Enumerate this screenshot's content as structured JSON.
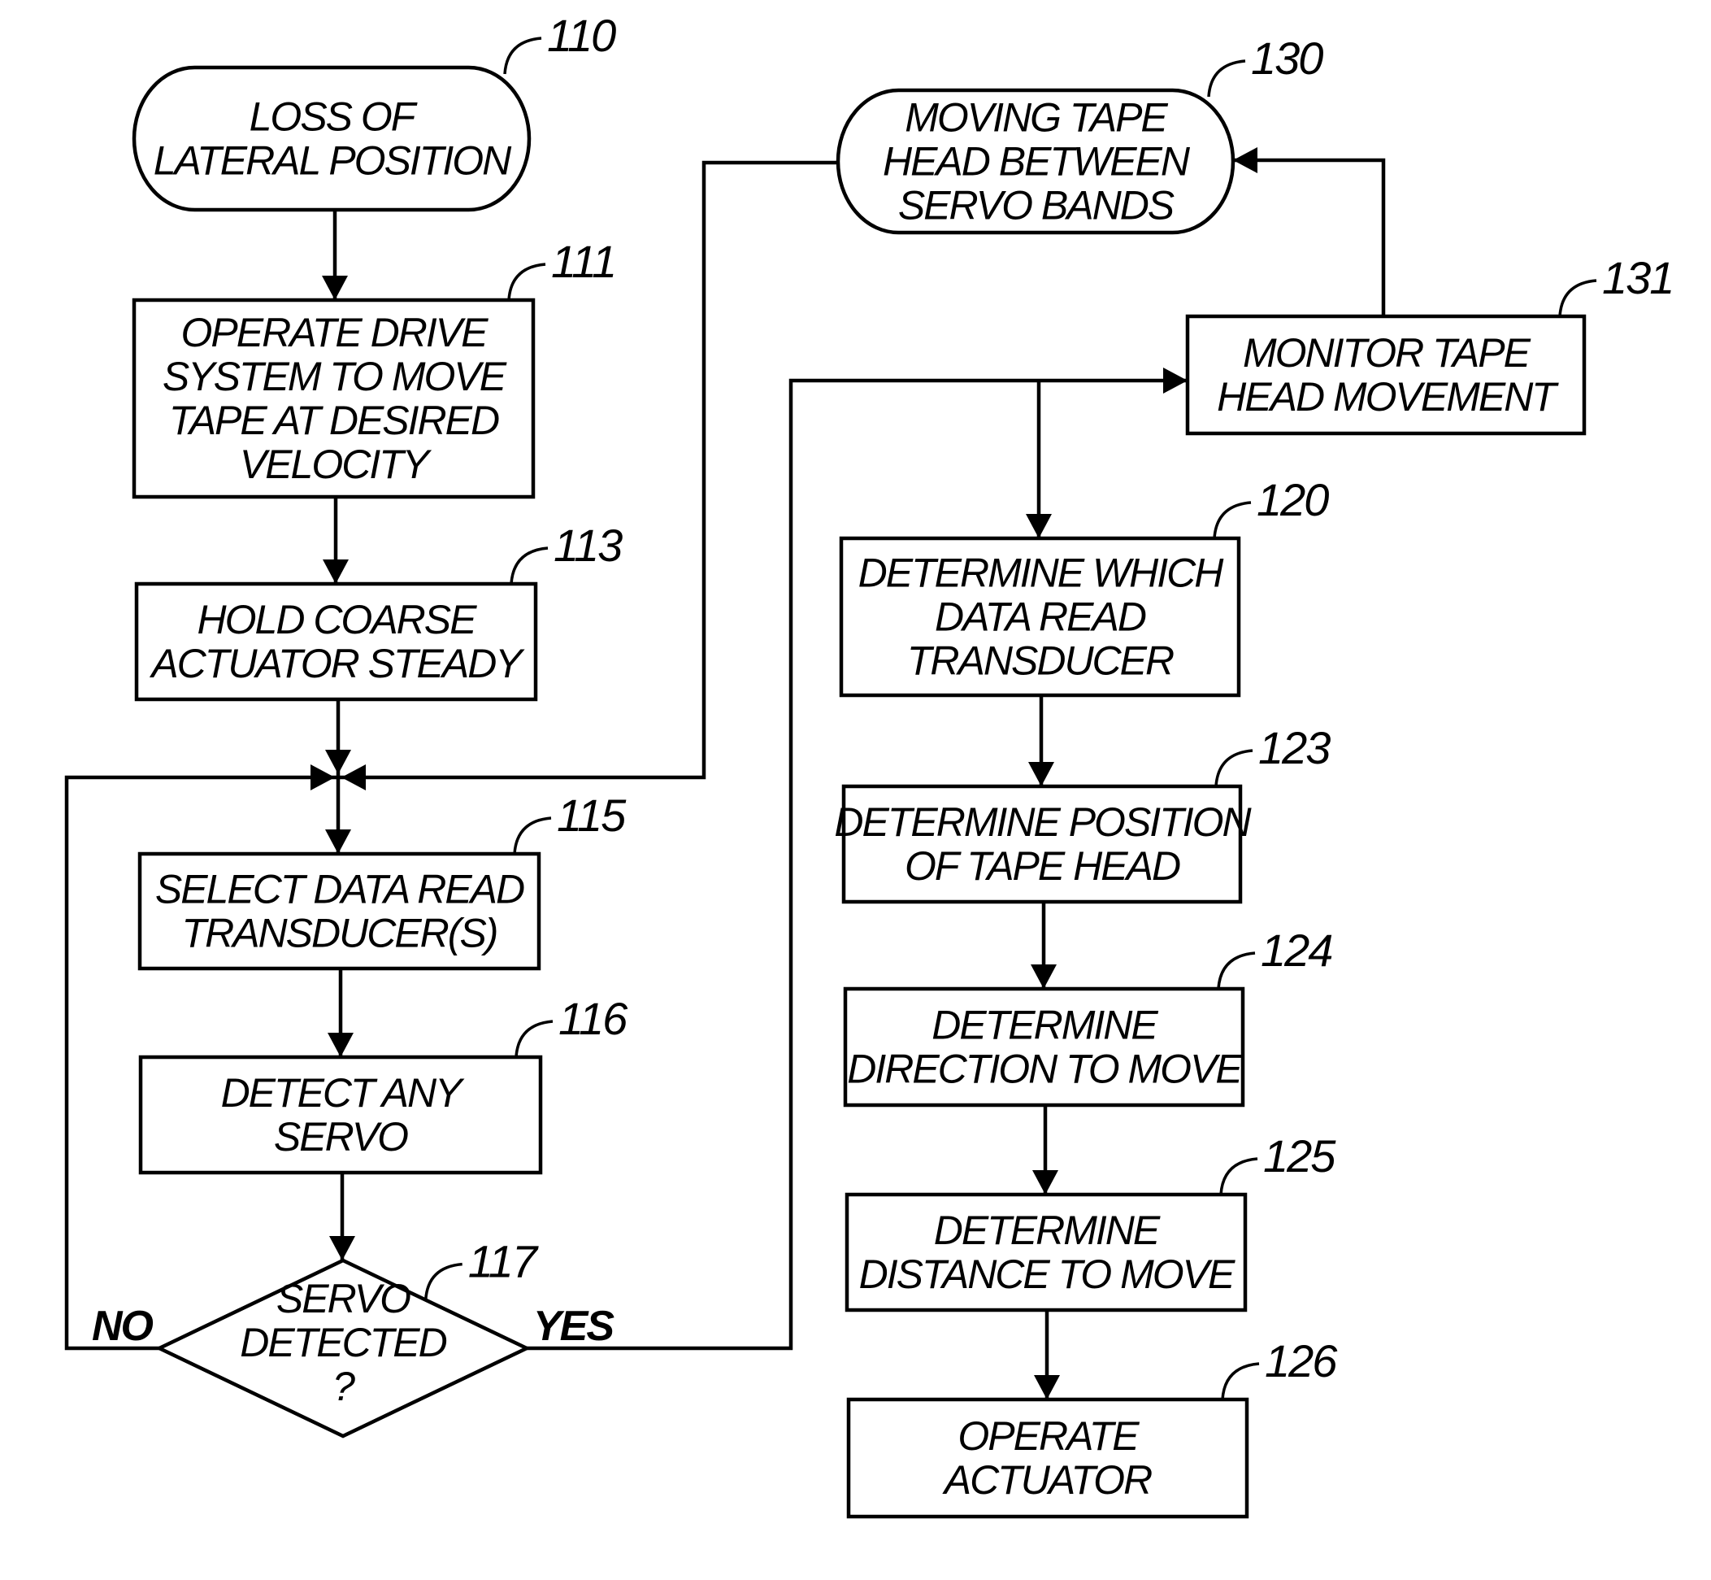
{
  "diagram": {
    "type": "flowchart",
    "nodes": [
      {
        "id": "110",
        "ref": "110",
        "shape": "terminal",
        "lines": [
          "LOSS OF",
          "LATERAL POSITION"
        ]
      },
      {
        "id": "111",
        "ref": "111",
        "shape": "process",
        "lines": [
          "OPERATE DRIVE",
          "SYSTEM TO MOVE",
          "TAPE AT DESIRED",
          "VELOCITY"
        ]
      },
      {
        "id": "113",
        "ref": "113",
        "shape": "process",
        "lines": [
          "HOLD COARSE",
          "ACTUATOR STEADY"
        ]
      },
      {
        "id": "115",
        "ref": "115",
        "shape": "process",
        "lines": [
          "SELECT DATA READ",
          "TRANSDUCER(S)"
        ]
      },
      {
        "id": "116",
        "ref": "116",
        "shape": "process",
        "lines": [
          "DETECT ANY",
          "SERVO"
        ]
      },
      {
        "id": "117",
        "ref": "117",
        "shape": "decision",
        "lines": [
          "SERVO",
          "DETECTED",
          "?"
        ]
      },
      {
        "id": "130",
        "ref": "130",
        "shape": "terminal",
        "lines": [
          "MOVING TAPE",
          "HEAD BETWEEN",
          "SERVO BANDS"
        ]
      },
      {
        "id": "131",
        "ref": "131",
        "shape": "process",
        "lines": [
          "MONITOR TAPE",
          "HEAD MOVEMENT"
        ]
      },
      {
        "id": "120",
        "ref": "120",
        "shape": "process",
        "lines": [
          "DETERMINE WHICH",
          "DATA READ",
          "TRANSDUCER"
        ]
      },
      {
        "id": "123",
        "ref": "123",
        "shape": "process",
        "lines": [
          "DETERMINE POSITION",
          "OF TAPE HEAD"
        ]
      },
      {
        "id": "124",
        "ref": "124",
        "shape": "process",
        "lines": [
          "DETERMINE",
          "DIRECTION TO MOVE"
        ]
      },
      {
        "id": "125",
        "ref": "125",
        "shape": "process",
        "lines": [
          "DETERMINE",
          "DISTANCE TO MOVE"
        ]
      },
      {
        "id": "126",
        "ref": "126",
        "shape": "process",
        "lines": [
          "OPERATE",
          "ACTUATOR"
        ]
      }
    ],
    "edges": [
      {
        "from": "110",
        "to": "111"
      },
      {
        "from": "111",
        "to": "113"
      },
      {
        "from": "113",
        "to": "115",
        "via": "junction"
      },
      {
        "from": "115",
        "to": "116"
      },
      {
        "from": "116",
        "to": "117"
      },
      {
        "from": "117",
        "to": "115",
        "label": "NO",
        "via": "junction"
      },
      {
        "from": "117",
        "to": "131",
        "label": "YES"
      },
      {
        "from": "117",
        "to": "120",
        "label": "YES"
      },
      {
        "from": "130",
        "to": "115",
        "via": "junction"
      },
      {
        "from": "131",
        "to": "130"
      },
      {
        "from": "120",
        "to": "123"
      },
      {
        "from": "123",
        "to": "124"
      },
      {
        "from": "124",
        "to": "125"
      },
      {
        "from": "125",
        "to": "126"
      }
    ],
    "branch_labels": {
      "no": "NO",
      "yes": "YES"
    }
  }
}
